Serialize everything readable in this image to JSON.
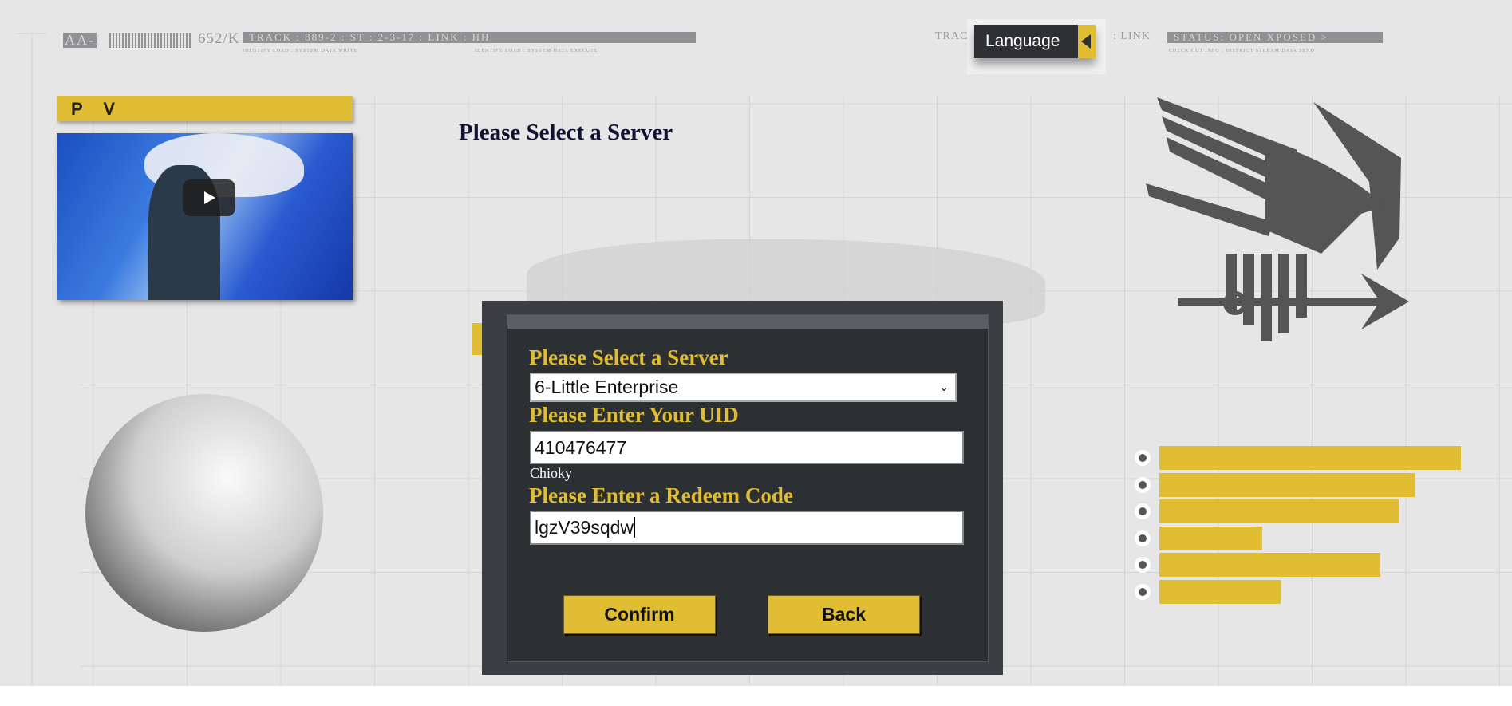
{
  "header": {
    "code": "AA-I",
    "counter": "652/K",
    "track_bar": "TRACK : 889-2 : ST : 2-3-17 : LINK : HH",
    "track_partial": "TRAC",
    "link_partial": ": LINK",
    "status_bar": "STATUS: OPEN XPOSED >",
    "sub_left": "IDENTIFY LOAD : SYSTEM DATA WRITE",
    "sub_mid": "IDENTIFY LOAD : SYSTEM DATA EXECUTE",
    "sub_right": "CHECK OUT INFO : DISTRICT STREAM DATA SEND"
  },
  "language_button": {
    "label": "Language",
    "icon": "caret-left-icon"
  },
  "pv": {
    "label": "P V",
    "play_icon": "play-icon"
  },
  "page_title": "Please Select a Server",
  "form": {
    "server_label": "Please Select a Server",
    "server_selected": "6-Little Enterprise",
    "uid_label": "Please Enter Your UID",
    "uid_value": "410476477",
    "player_name": "Chioky",
    "code_label": "Please Enter a Redeem Code",
    "code_value": "lgzV39sqdw",
    "confirm_label": "Confirm",
    "back_label": "Back"
  },
  "decor_bars": [
    0.97,
    0.82,
    0.77,
    0.33,
    0.71,
    0.39
  ],
  "colors": {
    "accent": "#e0bd33",
    "panel": "#2d3033",
    "background": "#e6e6e6"
  }
}
